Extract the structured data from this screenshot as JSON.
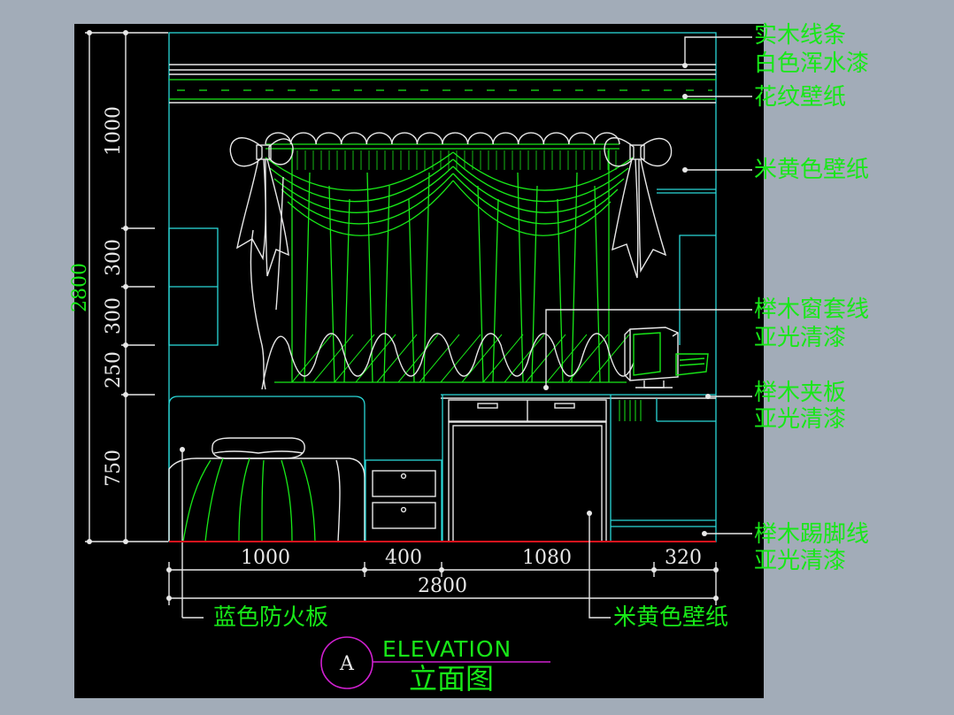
{
  "colors": {
    "background": "#a2acb8",
    "drawing_area": "#000000",
    "line_green": "#18e818",
    "line_cyan": "#2ad8d8",
    "line_white": "#e8e8e8",
    "floor_line": "#e0141e",
    "marker_circle": "#d020d0"
  },
  "dimensions": {
    "vertical_total": "2800",
    "vertical": [
      "1000",
      "300",
      "300",
      "250",
      "750"
    ],
    "horizontal": [
      "1000",
      "400",
      "1080",
      "320"
    ],
    "horizontal_total": "2800"
  },
  "labels": {
    "right": [
      "实木线条",
      "白色浑水漆",
      "花纹壁纸",
      "米黄色壁纸",
      "榉木窗套线",
      "亚光清漆",
      "榉木夹板",
      "亚光清漆",
      "榉木踢脚线",
      "亚光清漆"
    ],
    "bottom_left": "蓝色防火板",
    "bottom_right": "米黄色壁纸"
  },
  "title": {
    "marker": "A",
    "english": "ELEVATION",
    "chinese": "立面图"
  }
}
